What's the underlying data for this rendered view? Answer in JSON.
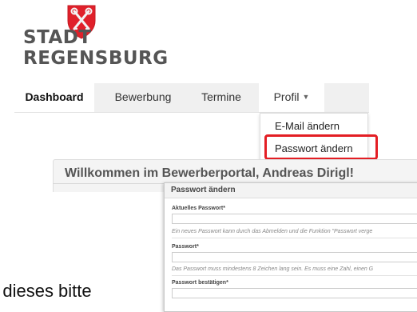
{
  "logo": {
    "line1": "STADT",
    "line2": "REGENSBURG",
    "shield_icon": "city-coat-of-arms-shield",
    "shield_color": "#e0202a",
    "text_color": "#555555"
  },
  "nav": {
    "tabs": [
      {
        "label": "Dashboard",
        "active": true
      },
      {
        "label": "Bewerbung"
      },
      {
        "label": "Termine"
      },
      {
        "label": "Profil",
        "dropdown": true
      }
    ],
    "caret_icon": "caret-down-icon"
  },
  "profile_menu": {
    "items": [
      {
        "label": "E-Mail ändern"
      },
      {
        "label": "Passwort ändern",
        "highlighted": true
      }
    ],
    "highlight_color": "#e31e24"
  },
  "welcome": {
    "title": "Willkommen im Bewerberportal, Andreas Dirigl!"
  },
  "dialog": {
    "title": "Passwort ändern",
    "fields": [
      {
        "label": "Aktuelles Passwort*",
        "value": "",
        "hint": "Ein neues Passwort kann durch das Abmelden und die Funktion \"Passwort verge"
      },
      {
        "label": "Passwort*",
        "value": "",
        "hint": "Das Passwort muss mindestens 8 Zeichen lang sein. Es muss eine Zahl, einen G"
      },
      {
        "label": "Passwort bestätigen*",
        "value": ""
      }
    ]
  },
  "background_text": "e dieses bitte"
}
